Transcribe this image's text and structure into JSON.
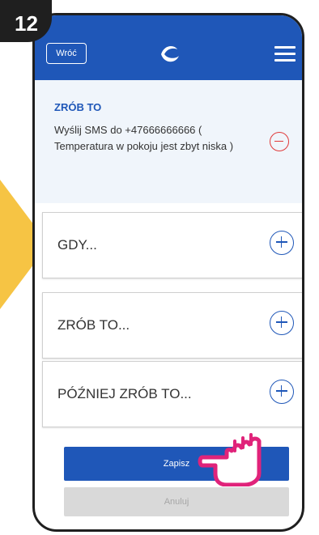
{
  "step": {
    "number": "12"
  },
  "header": {
    "back_label": "Wróć",
    "logo": "brand-logo",
    "menu_icon": "hamburger-menu-icon"
  },
  "action": {
    "heading": "ZRÓB TO",
    "description": "Wyślij SMS do +47666666666 ( Temperatura w pokoju jest zbyt niska )",
    "remove_icon": "minus-circle-icon"
  },
  "sections": [
    {
      "label": "GDY...",
      "icon": "plus-circle-icon"
    },
    {
      "label": "ZRÓB TO...",
      "icon": "plus-circle-icon"
    },
    {
      "label": "PÓŹNIEJ ZRÓB TO...",
      "icon": "plus-circle-icon"
    }
  ],
  "buttons": {
    "save": "Zapisz",
    "cancel": "Anuluj"
  },
  "colors": {
    "primary": "#1f57b8",
    "remove": "#e03a3a",
    "accent_arrow": "#f6c444",
    "hand": "#e0237a"
  },
  "overlay": {
    "hand_icon": "pointing-hand-icon"
  }
}
